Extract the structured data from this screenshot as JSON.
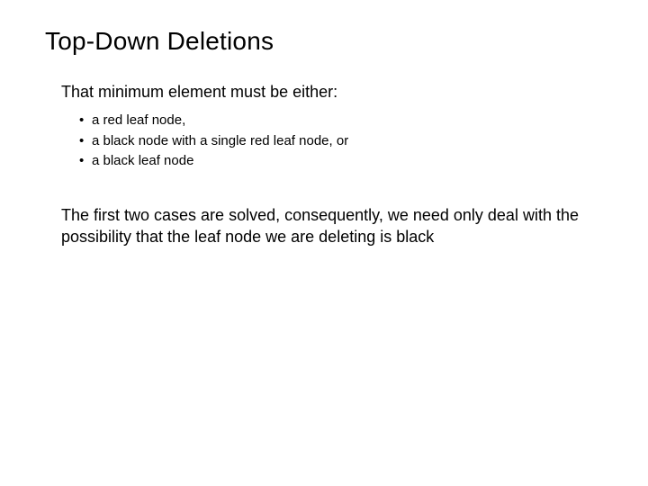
{
  "title": "Top-Down Deletions",
  "lead": "That minimum element must be either:",
  "bullets": [
    "a red leaf node,",
    "a black node with a single red leaf node, or",
    "a black leaf node"
  ],
  "paragraph": "The first two cases are solved, consequently, we need only deal with the possibility that the leaf node we are deleting is black"
}
